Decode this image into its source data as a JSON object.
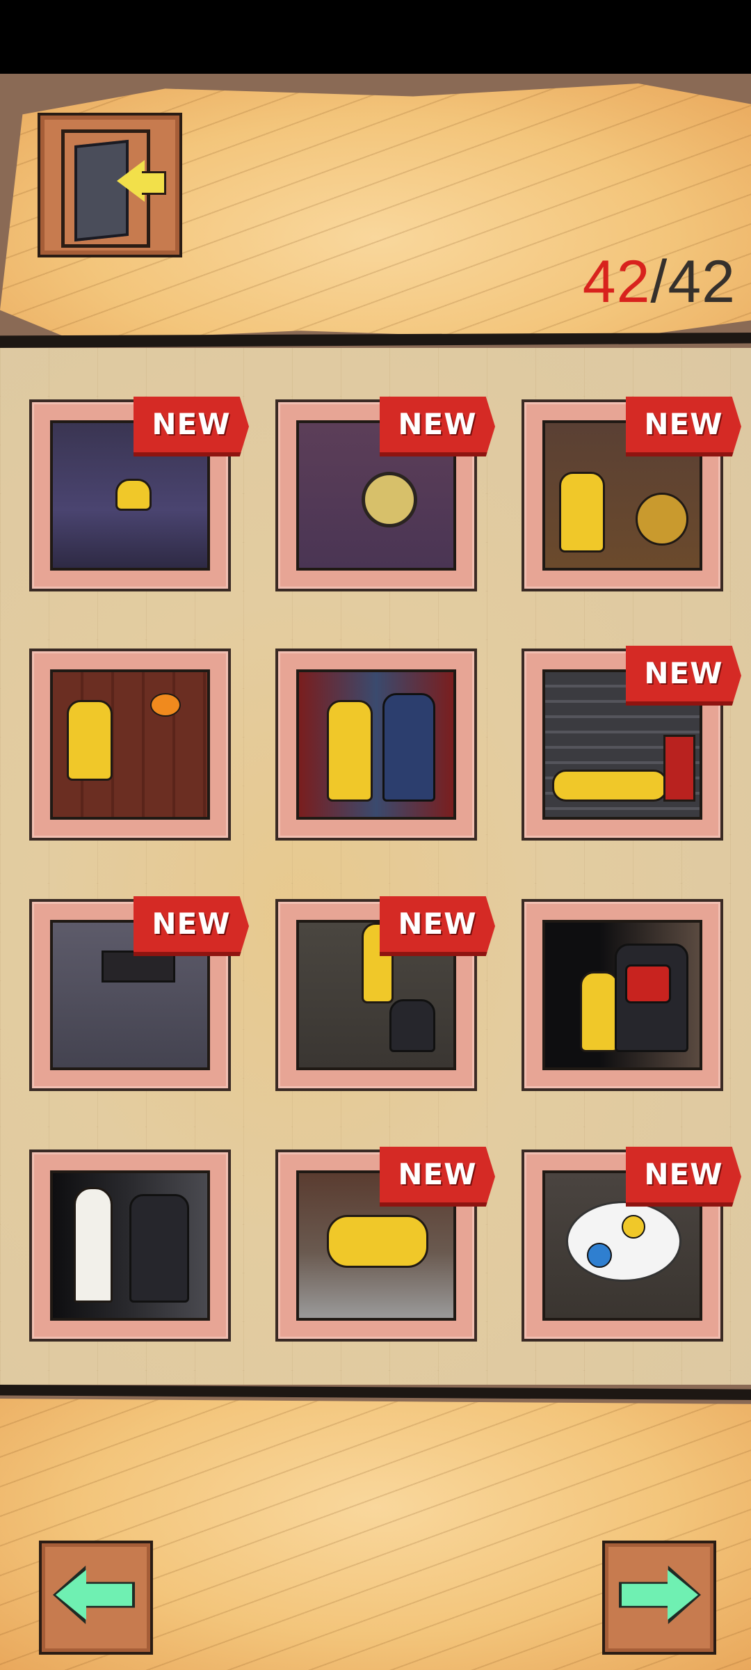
{
  "header": {
    "exit_icon": "exit-door-icon",
    "progress_current": "42",
    "progress_separator": "/",
    "progress_total": "42"
  },
  "badge_label": "NEW",
  "levels": [
    {
      "name": "level-1",
      "new": true
    },
    {
      "name": "level-2",
      "new": true
    },
    {
      "name": "level-3",
      "new": true
    },
    {
      "name": "level-4",
      "new": false
    },
    {
      "name": "level-5",
      "new": false
    },
    {
      "name": "level-6",
      "new": true
    },
    {
      "name": "level-7",
      "new": true
    },
    {
      "name": "level-8",
      "new": true
    },
    {
      "name": "level-9",
      "new": false
    },
    {
      "name": "level-10",
      "new": false
    },
    {
      "name": "level-11",
      "new": true
    },
    {
      "name": "level-12",
      "new": true
    }
  ],
  "footer": {
    "prev_icon": "arrow-left-icon",
    "next_icon": "arrow-right-icon"
  },
  "colors": {
    "accent_red": "#d8221d",
    "arrow_green": "#6ff0b2",
    "panel_orange": "#f3c57b"
  }
}
